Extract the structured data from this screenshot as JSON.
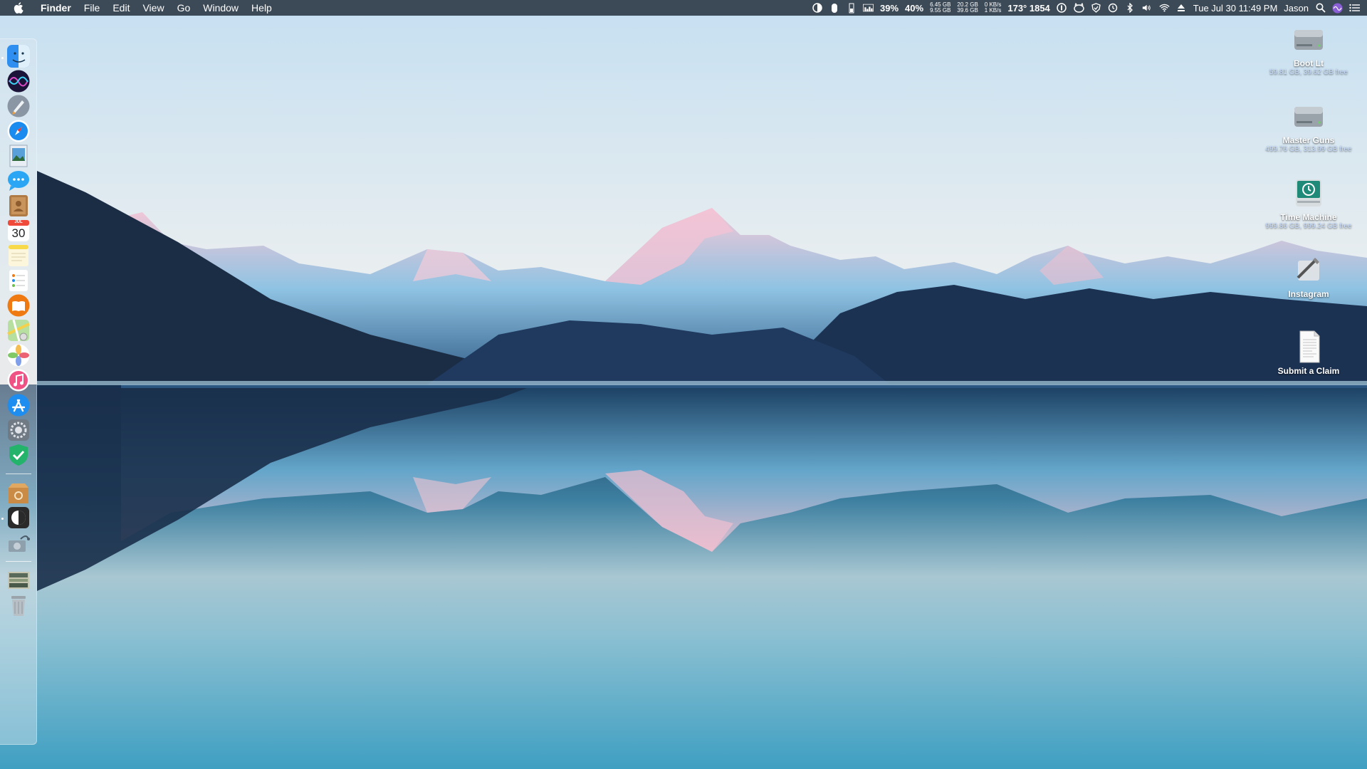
{
  "menubar": {
    "app_name": "Finder",
    "menus": [
      "File",
      "Edit",
      "View",
      "Go",
      "Window",
      "Help"
    ],
    "status": {
      "battery_percent": "39%",
      "cpu_percent": "40%",
      "memory_top": "6.45 GB",
      "memory_bottom": "9.55 GB",
      "disk_top": "20.2 GB",
      "disk_bottom": "39.6 GB",
      "net_up": "0 KB/s",
      "net_down": "1 KB/s",
      "temp_fan": "173° 1854",
      "datetime": "Tue Jul 30  11:49 PM",
      "user": "Jason"
    }
  },
  "dock": {
    "items": [
      {
        "name": "finder-icon",
        "color": "#2f8ff0"
      },
      {
        "name": "siri-icon",
        "color": "#6b3fd0"
      },
      {
        "name": "launchpad-icon",
        "color": "#8a96a4"
      },
      {
        "name": "safari-icon",
        "color": "#1a8cf0"
      },
      {
        "name": "preview-icon",
        "color": "#5aa0d8"
      },
      {
        "name": "messages-icon",
        "color": "#2aa6f5"
      },
      {
        "name": "contacts-icon",
        "color": "#b07a45"
      },
      {
        "name": "calendar-icon",
        "color": "#ffffff"
      },
      {
        "name": "notes-icon",
        "color": "#f8e27a"
      },
      {
        "name": "reminders-icon",
        "color": "#ffffff"
      },
      {
        "name": "books-icon",
        "color": "#f07a12"
      },
      {
        "name": "maps-icon",
        "color": "#6fc36a"
      },
      {
        "name": "photos-icon",
        "color": "#f3b232"
      },
      {
        "name": "itunes-icon",
        "color": "#f05286"
      },
      {
        "name": "app-store-icon",
        "color": "#1d8df0"
      },
      {
        "name": "system-preferences-icon",
        "color": "#707a84"
      },
      {
        "name": "shield-check-icon",
        "color": "#23b36b"
      },
      {
        "name": "archive-utility-icon",
        "color": "#c98b46"
      },
      {
        "name": "halfmoon-app-icon",
        "color": "#2a2a2a"
      },
      {
        "name": "disk-utility-icon",
        "color": "#8fa0ad"
      },
      {
        "name": "downloads-stack-icon",
        "color": "#c6c6b0"
      },
      {
        "name": "trash-icon",
        "color": "#b8c0c6"
      }
    ],
    "calendar_month": "JUL",
    "calendar_day": "30"
  },
  "desktop": {
    "items": [
      {
        "name": "Boot Lt",
        "info": "59.81 GB, 39.62 GB free"
      },
      {
        "name": "Master Guns",
        "info": "499.76 GB, 313.99 GB free"
      },
      {
        "name": "Time Machine",
        "info": "999.86 GB, 999.24 GB free"
      },
      {
        "name": "Instagram",
        "info": ""
      },
      {
        "name": "Submit a Claim",
        "info": ""
      }
    ]
  },
  "colors": {
    "menubar": "#3c4a57",
    "sky_top": "#c7e0f2",
    "sky_horizon": "#f2ece6",
    "mountain_dark": "#1b3050",
    "lake_bottom": "#4fa9c8"
  }
}
